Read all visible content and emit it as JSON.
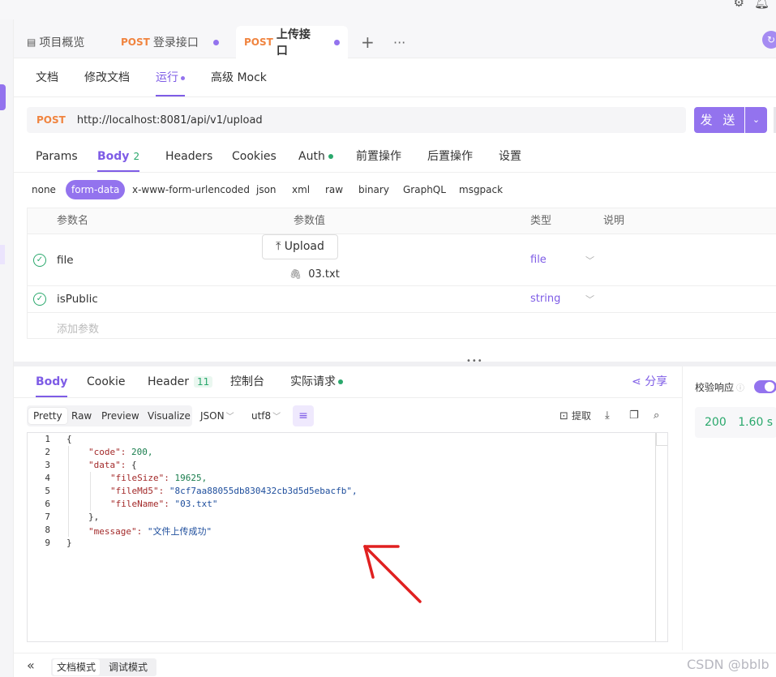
{
  "top_icons": [
    "gear-icon",
    "bell-icon"
  ],
  "tabs": {
    "overview": "项目概览",
    "login_method": "POST",
    "login_label": "登录接口",
    "upload_method": "POST",
    "upload_label": "上传接口",
    "add": "+",
    "more": "···"
  },
  "subnav": {
    "doc": "文档",
    "edit_doc": "修改文档",
    "run": "运行",
    "mock": "高级 Mock"
  },
  "request": {
    "method": "POST",
    "url": "http://localhost:8081/api/v1/upload",
    "send": "发 送"
  },
  "param_tabs": {
    "params": "Params",
    "body": "Body",
    "body_count": "2",
    "headers": "Headers",
    "cookies": "Cookies",
    "auth": "Auth",
    "pre": "前置操作",
    "post": "后置操作",
    "settings": "设置"
  },
  "body_types": {
    "none": "none",
    "form_data": "form-data",
    "urlencoded": "x-www-form-urlencoded",
    "json": "json",
    "xml": "xml",
    "raw": "raw",
    "binary": "binary",
    "graphql": "GraphQL",
    "msgpack": "msgpack"
  },
  "param_table": {
    "headers": {
      "name": "参数名",
      "value": "参数值",
      "type": "类型",
      "desc": "说明"
    },
    "rows": [
      {
        "name": "file",
        "type": "file",
        "upload_label": "Upload",
        "file_name": "03.txt"
      },
      {
        "name": "isPublic",
        "type": "string"
      }
    ],
    "add_placeholder": "添加参数"
  },
  "response_tabs": {
    "body": "Body",
    "cookie": "Cookie",
    "header": "Header",
    "header_count": "11",
    "console": "控制台",
    "actual": "实际请求",
    "share": "分享"
  },
  "view_bar": {
    "pretty": "Pretty",
    "raw": "Raw",
    "preview": "Preview",
    "visualize": "Visualize",
    "format": "JSON",
    "encoding": "utf8",
    "extract": "提取"
  },
  "code_lines": [
    "{",
    "\"code\": 200,",
    "\"data\": {",
    "\"fileSize\": 19625,",
    "\"fileMd5\": \"8cf7aa88055db830432cb3d5d5ebacfb\",",
    "\"fileName\": \"03.txt\"",
    "},",
    "\"message\": \"文件上传成功\"",
    "}"
  ],
  "line_numbers": [
    "1",
    "2",
    "3",
    "4",
    "5",
    "6",
    "7",
    "8",
    "9"
  ],
  "right_panel": {
    "verify_label": "校验响应",
    "status": "200",
    "time": "1.60 s",
    "size_partial": "1"
  },
  "bottom": {
    "collapse": "«",
    "doc_mode": "文档模式",
    "debug_mode": "调试模式",
    "watermark": "CSDN @bblb"
  },
  "colors": {
    "accent": "#9373ee",
    "method": "#f0843f",
    "success": "#2aa86c",
    "arrow": "#e02020"
  }
}
